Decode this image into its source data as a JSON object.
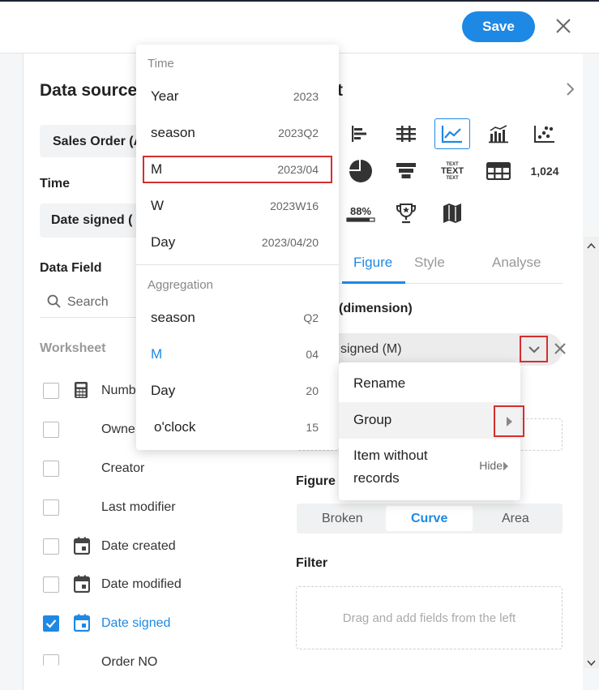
{
  "header": {
    "save_label": "Save",
    "close_icon": "close-icon"
  },
  "left_panel": {
    "title": "Data source",
    "source_value": "Sales Order (A",
    "time_label": "Time",
    "time_value": "Date signed (",
    "data_field_label": "Data Field",
    "search_placeholder": "Search",
    "worksheet_label": "Worksheet",
    "fields": [
      {
        "label": "Numb",
        "checked": false,
        "icon": "calculator-icon"
      },
      {
        "label": "Owne",
        "checked": false,
        "icon": ""
      },
      {
        "label": "Creator",
        "checked": false,
        "icon": ""
      },
      {
        "label": "Last modifier",
        "checked": false,
        "icon": ""
      },
      {
        "label": "Date created",
        "checked": false,
        "icon": "calendar-icon"
      },
      {
        "label": "Date modified",
        "checked": false,
        "icon": "calendar-icon"
      },
      {
        "label": "Date signed",
        "checked": true,
        "icon": "calendar-icon"
      },
      {
        "label": "Order NO",
        "checked": false,
        "icon": ""
      }
    ]
  },
  "right_panel": {
    "title_tail": "t",
    "chart_text_icon_label": "TEXT",
    "chart_number_icon_label": "1,024",
    "chart_percent_icon_label": "88%",
    "tabs": [
      "Figure",
      "Style",
      "Analyse"
    ],
    "active_tab": "Figure",
    "dimension_label": "(dimension)",
    "dimension_value": "signed (M)",
    "figure_label": "Figure",
    "figure_options": [
      "Broken",
      "Curve",
      "Area"
    ],
    "figure_selected": "Curve",
    "filter_label": "Filter",
    "filter_placeholder": "Drag and add fields from the left"
  },
  "time_menu": {
    "time_header": "Time",
    "time_items": [
      {
        "label": "Year",
        "value": "2023"
      },
      {
        "label": "season",
        "value": "2023Q2"
      },
      {
        "label": "M",
        "value": "2023/04"
      },
      {
        "label": "W",
        "value": "2023W16"
      },
      {
        "label": "Day",
        "value": "2023/04/20"
      }
    ],
    "aggregation_header": "Aggregation",
    "aggregation_items": [
      {
        "label": "season",
        "value": "Q2"
      },
      {
        "label": "M",
        "value": "04"
      },
      {
        "label": "Day",
        "value": "20"
      },
      {
        "label": "o'clock",
        "value": "15"
      }
    ]
  },
  "context_menu": {
    "rename": "Rename",
    "group": "Group",
    "item_without_records_line1": "Item without",
    "item_without_records_line2": "records",
    "hide": "Hide"
  },
  "colors": {
    "accent": "#1e88e5",
    "highlight_box": "#d32f2f"
  }
}
